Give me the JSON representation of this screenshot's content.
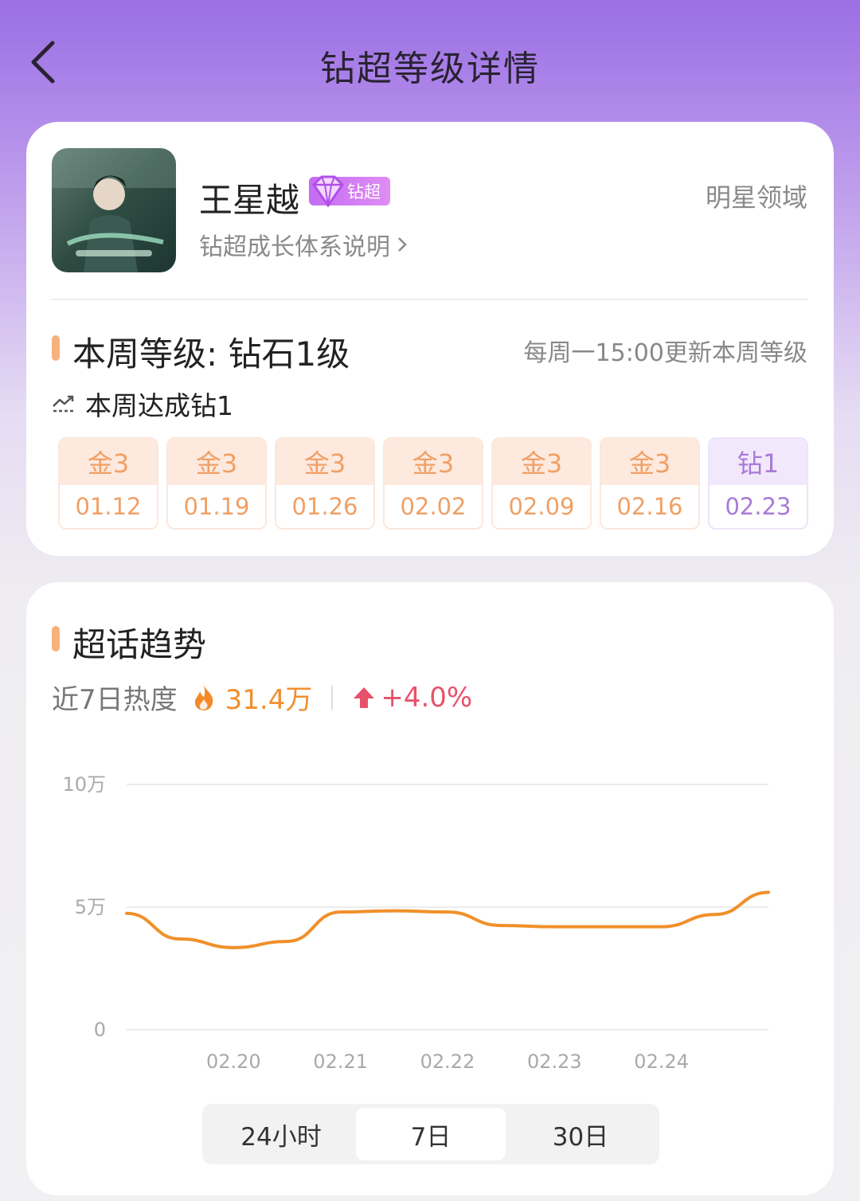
{
  "header": {
    "title": "钻超等级详情",
    "back_icon": "chevron-left-icon"
  },
  "profile": {
    "name": "王星越",
    "badge_label": "钻超",
    "growth_link": "钻超成长体系说明",
    "domain_label": "明星领域"
  },
  "level": {
    "title": "本周等级: 钻石1级",
    "update_note": "每周一15:00更新本周等级",
    "achievement": "本周达成钻1",
    "weeks": [
      {
        "level": "金3",
        "date": "01.12"
      },
      {
        "level": "金3",
        "date": "01.19"
      },
      {
        "level": "金3",
        "date": "01.26"
      },
      {
        "level": "金3",
        "date": "02.02"
      },
      {
        "level": "金3",
        "date": "02.09"
      },
      {
        "level": "金3",
        "date": "02.16"
      },
      {
        "level": "钻1",
        "date": "02.23"
      }
    ]
  },
  "trend": {
    "title": "超话趋势",
    "heat_label": "近7日热度",
    "heat_value": "31.4万",
    "heat_change": "+4.0%",
    "tabs": [
      "24小时",
      "7日",
      "30日"
    ],
    "active_tab": "7日"
  },
  "colors": {
    "accent_orange": "#f09030",
    "line": "#f0902a",
    "diamond": "#a77bd8",
    "change_red": "#e8516b"
  },
  "chart_data": {
    "type": "line",
    "x": [
      "02.19",
      "02.19.5",
      "02.20",
      "02.20.5",
      "02.21",
      "02.21.5",
      "02.22",
      "02.22.5",
      "02.23",
      "02.23.5",
      "02.24",
      "02.24.5",
      "02.25"
    ],
    "x_tick_labels": [
      "02.20",
      "02.21",
      "02.22",
      "02.23",
      "02.24"
    ],
    "y_tick_labels": [
      "10万",
      "5万",
      "0"
    ],
    "y_ticks": [
      100000,
      50000,
      0
    ],
    "ylim": [
      0,
      100000
    ],
    "series": [
      {
        "values": [
          47500,
          37000,
          33500,
          36000,
          48000,
          48500,
          48000,
          42500,
          42000,
          42000,
          42000,
          47000,
          56000
        ]
      }
    ],
    "grid": true
  }
}
